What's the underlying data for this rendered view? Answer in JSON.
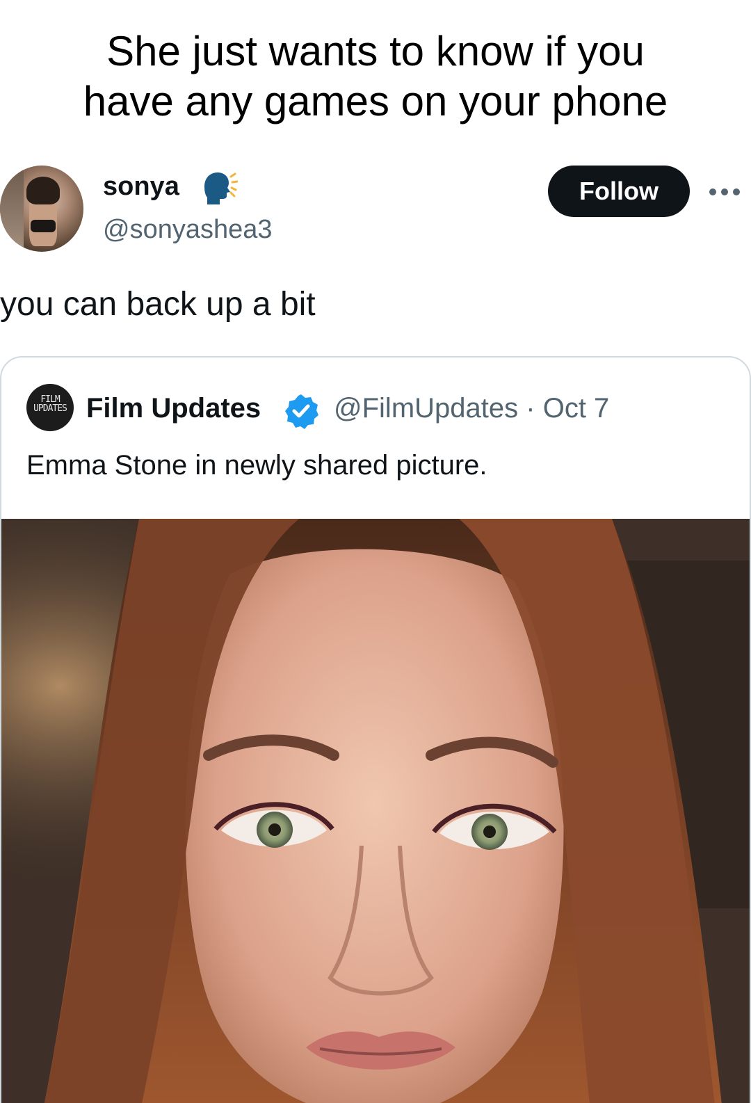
{
  "caption": {
    "line1": "She just wants to know if you",
    "line2": "have any games on your phone"
  },
  "tweet": {
    "display_name": "sonya",
    "name_emoji_icon": "speaking-head-icon",
    "handle": "@sonyashea3",
    "follow_label": "Follow",
    "more_icon": "more-options-icon",
    "text": "you can back up a bit"
  },
  "quote": {
    "avatar_text": "FILM UPDATES",
    "name": "Film Updates",
    "verified_icon": "verified-badge-icon",
    "handle": "@FilmUpdates",
    "separator": "·",
    "date": "Oct 7",
    "text": "Emma Stone in newly shared picture.",
    "image": "portrait-photo"
  },
  "colors": {
    "text_primary": "#0f1419",
    "text_secondary": "#536471",
    "follow_bg": "#0f1419",
    "verified_blue": "#1d9bf0",
    "card_border": "#cfd9de"
  }
}
